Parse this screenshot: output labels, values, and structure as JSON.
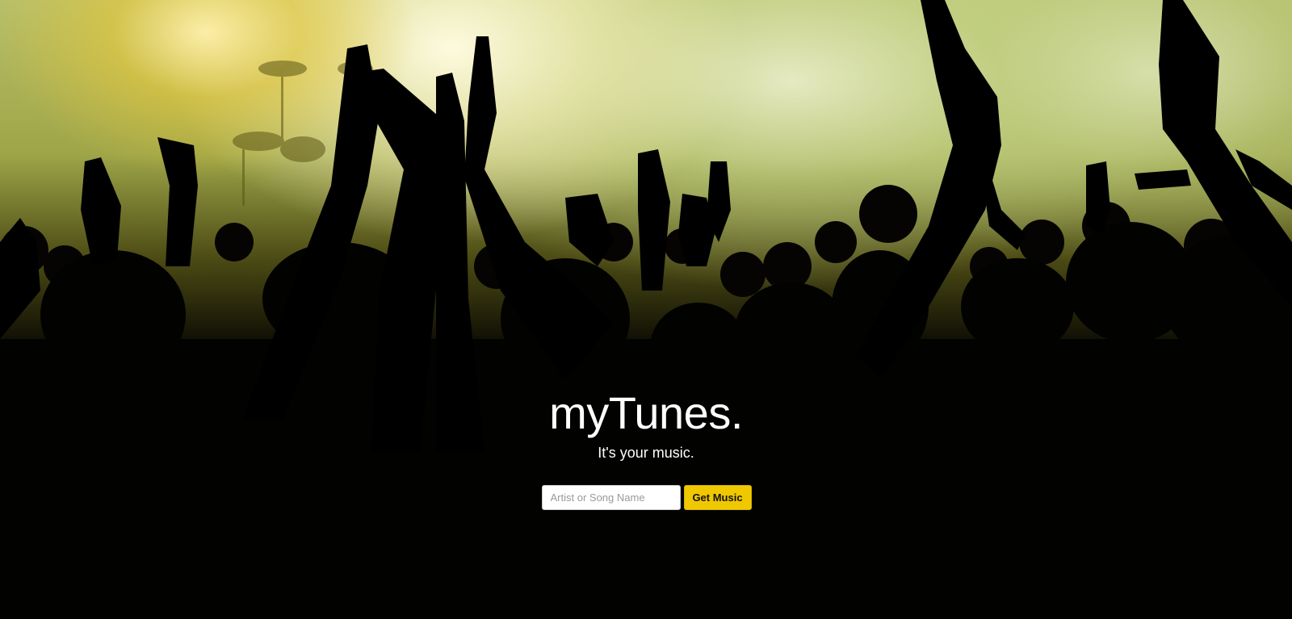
{
  "hero": {
    "brand": "myTunes.",
    "tagline": "It's your music."
  },
  "search": {
    "placeholder": "Artist or Song Name",
    "value": "",
    "button_label": "Get Music"
  },
  "colors": {
    "button_accent": "#f0c800",
    "text": "#ffffff",
    "background": "#000000"
  }
}
